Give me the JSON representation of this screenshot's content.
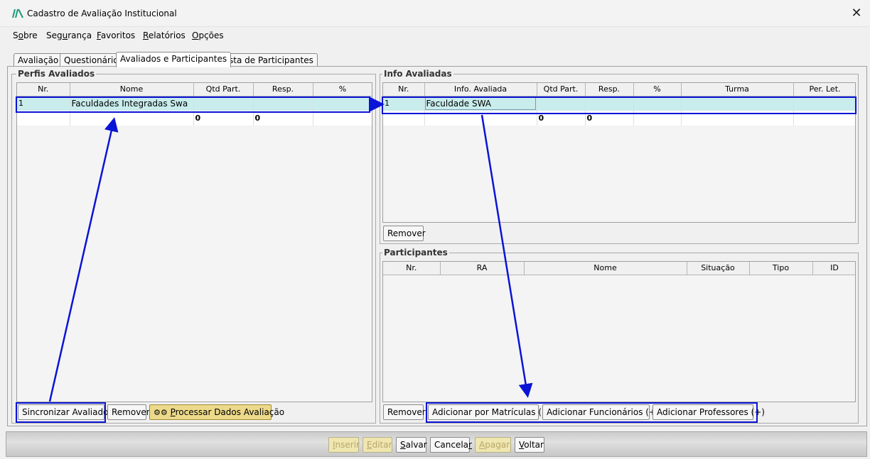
{
  "window": {
    "title": "Cadastro de Avaliação Institucional",
    "close_glyph": "✕"
  },
  "menu": [
    {
      "pre": "S",
      "u": "o",
      "post": "bre"
    },
    {
      "pre": "Seg",
      "u": "u",
      "post": "rança"
    },
    {
      "pre": "",
      "u": "F",
      "post": "avoritos"
    },
    {
      "pre": "",
      "u": "R",
      "post": "elatórios"
    },
    {
      "pre": "",
      "u": "O",
      "post": "pções"
    }
  ],
  "tabs": [
    "Avaliação",
    "Questionário",
    "Avaliados e Participantes",
    "Lista de Participantes"
  ],
  "perfis": {
    "title": "Perfis Avaliados",
    "columns": [
      "Nr.",
      "Nome",
      "Qtd Part.",
      "Resp.",
      "%"
    ],
    "row": [
      "1",
      "Faculdades Integradas Swa",
      "",
      "",
      ""
    ],
    "totals": [
      "",
      "",
      "0",
      "0",
      ""
    ],
    "buttons": {
      "sync": "Sincronizar Avaliados",
      "remove": "Remover",
      "process_u": "P",
      "process_rest": "rocessar Dados Avaliação"
    }
  },
  "info": {
    "title": "Info Avaliadas",
    "columns": [
      "Nr.",
      "Info. Avaliada",
      "Qtd Part.",
      "Resp.",
      "%",
      "Turma",
      "Per. Let."
    ],
    "row": [
      "1",
      "Faculdade SWA",
      "",
      "",
      "",
      "",
      ""
    ],
    "totals": [
      "",
      "",
      "0",
      "0",
      "",
      "",
      ""
    ],
    "remove": "Remover"
  },
  "participantes": {
    "title": "Participantes",
    "columns": [
      "Nr.",
      "RA",
      "Nome",
      "Situação",
      "Tipo",
      "ID"
    ],
    "buttons": {
      "remove": "Remover",
      "matriculas": "Adicionar por Matrículas (+)",
      "funcionarios": "Adicionar Funcionários (+)",
      "professores": "Adicionar Professores (+)"
    }
  },
  "footer": {
    "inserir": {
      "u": "I",
      "rest": "nserir"
    },
    "editar": {
      "u": "E",
      "rest": "ditar"
    },
    "salvar": {
      "u": "S",
      "rest": "alvar"
    },
    "cancelar": {
      "pre": "Cancela",
      "u": "r"
    },
    "apagar": {
      "u": "A",
      "rest": "pagar"
    },
    "voltar": {
      "u": "V",
      "rest": "oltar"
    }
  },
  "colors": {
    "accent": "#0a14d6",
    "selected_row": "#c9ecec",
    "process_button": "#ecd98a",
    "app_icon": "#1a9a7a"
  }
}
